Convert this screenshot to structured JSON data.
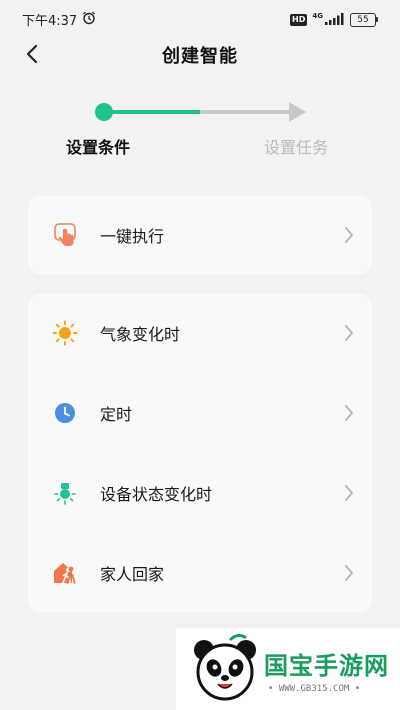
{
  "status_bar": {
    "time": "下午4:37",
    "hd_badge": "HD",
    "network": "4G",
    "battery": "55",
    "icons": [
      "alarm-icon",
      "signal-icon",
      "battery-icon"
    ]
  },
  "header": {
    "title": "创建智能",
    "back_icon": "chevron-left-icon"
  },
  "stepper": {
    "steps": [
      {
        "label": "设置条件",
        "state": "active"
      },
      {
        "label": "设置任务",
        "state": "inactive"
      }
    ],
    "progress": 0.5,
    "colors": {
      "active": "#20c58a",
      "inactive": "#c8c8c8"
    }
  },
  "manual_card": {
    "items": [
      {
        "label": "一键执行",
        "icon": "tap-hand-icon"
      }
    ]
  },
  "conditions_card": {
    "items": [
      {
        "label": "气象变化时",
        "icon": "sun-icon"
      },
      {
        "label": "定时",
        "icon": "clock-icon"
      },
      {
        "label": "设备状态变化时",
        "icon": "device-bulb-icon"
      },
      {
        "label": "家人回家",
        "icon": "person-home-icon"
      }
    ]
  },
  "watermark": {
    "text": "国宝手游网",
    "url": "• WWW.GB315.COM •"
  }
}
